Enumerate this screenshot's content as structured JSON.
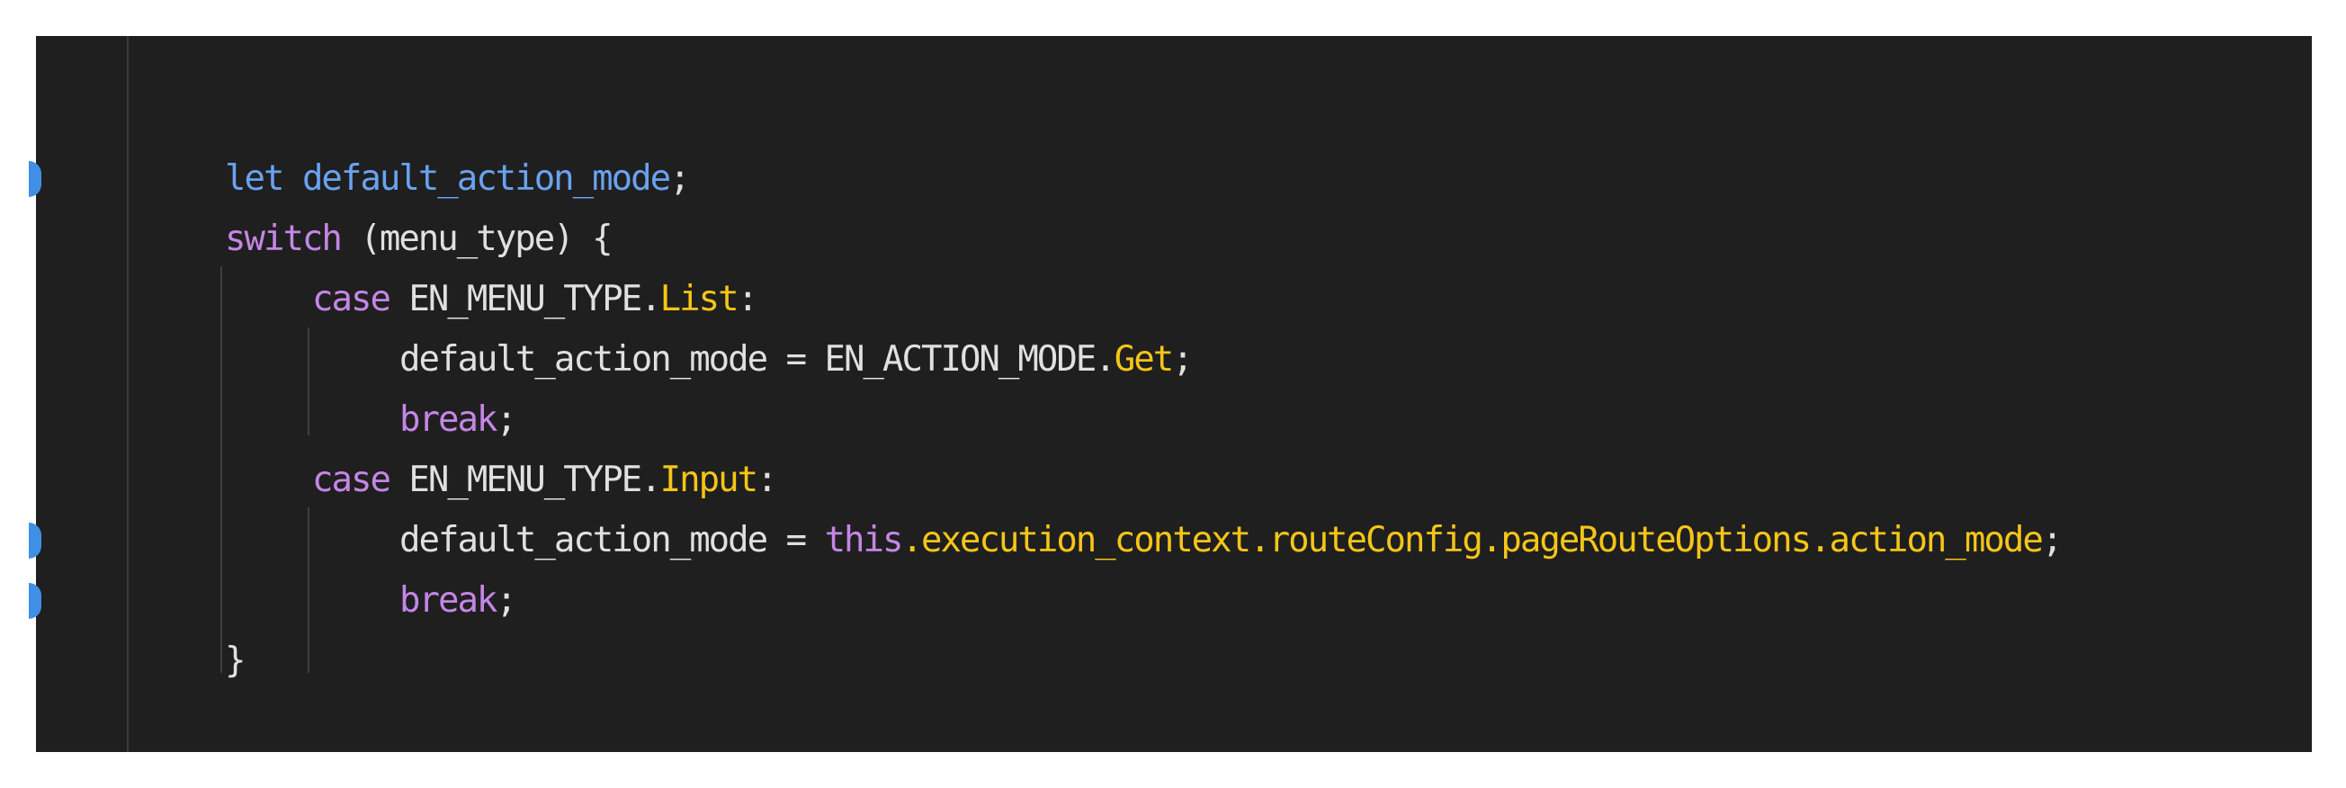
{
  "editor": {
    "colors": {
      "background": "#1f1f1f",
      "keyword": "#c586e6",
      "declaration": "#6aa2f0",
      "property": "#f5c518",
      "text": "#e0e0e0",
      "marker": "#3f8fe6"
    },
    "lines": [
      {
        "indent": 0,
        "tokens": [
          {
            "t": "let",
            "c": "decl"
          },
          {
            "t": " ",
            "c": "plain"
          },
          {
            "t": "default_action_mode",
            "c": "decl"
          },
          {
            "t": ";",
            "c": "plain"
          }
        ]
      },
      {
        "indent": 0,
        "tokens": [
          {
            "t": "switch",
            "c": "kw"
          },
          {
            "t": " (menu_type) {",
            "c": "plain"
          }
        ]
      },
      {
        "indent": 1,
        "tokens": [
          {
            "t": "case",
            "c": "kw"
          },
          {
            "t": " EN_MENU_TYPE.",
            "c": "plain"
          },
          {
            "t": "List",
            "c": "prop"
          },
          {
            "t": ":",
            "c": "plain"
          }
        ]
      },
      {
        "indent": 2,
        "tokens": [
          {
            "t": "default_action_mode = EN_ACTION_MODE.",
            "c": "plain"
          },
          {
            "t": "Get",
            "c": "prop"
          },
          {
            "t": ";",
            "c": "plain"
          }
        ]
      },
      {
        "indent": 2,
        "tokens": [
          {
            "t": "break",
            "c": "kw"
          },
          {
            "t": ";",
            "c": "plain"
          }
        ]
      },
      {
        "indent": 1,
        "tokens": [
          {
            "t": "case",
            "c": "kw"
          },
          {
            "t": " EN_MENU_TYPE.",
            "c": "plain"
          },
          {
            "t": "Input",
            "c": "prop"
          },
          {
            "t": ":",
            "c": "plain"
          }
        ]
      },
      {
        "indent": 2,
        "tokens": [
          {
            "t": "default_action_mode = ",
            "c": "plain"
          },
          {
            "t": "this",
            "c": "kw"
          },
          {
            "t": ".execution_context.routeConfig.pageRouteOptions.action_mode",
            "c": "prop"
          },
          {
            "t": ";",
            "c": "plain"
          }
        ]
      },
      {
        "indent": 2,
        "tokens": [
          {
            "t": "break",
            "c": "kw"
          },
          {
            "t": ";",
            "c": "plain"
          }
        ]
      },
      {
        "indent": 0,
        "tokens": [
          {
            "t": "}",
            "c": "plain"
          }
        ]
      }
    ],
    "modified_line_markers": [
      0,
      6,
      7
    ]
  }
}
